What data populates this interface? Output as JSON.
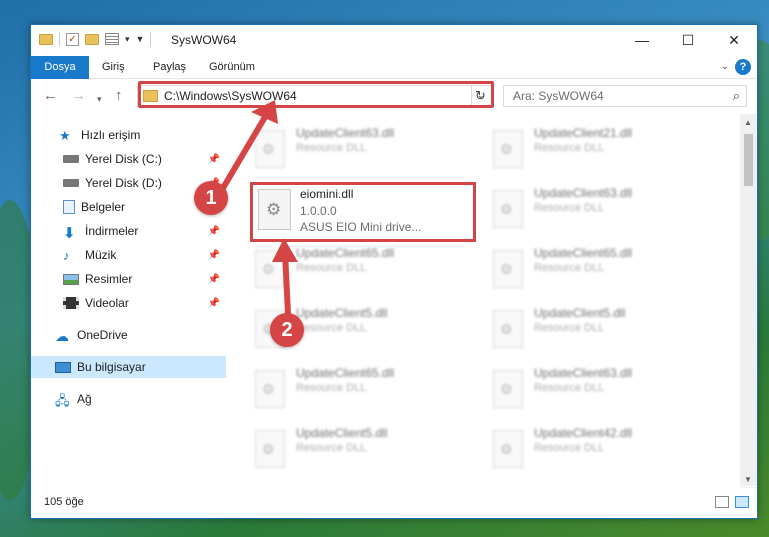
{
  "window": {
    "title": "SysWOW64"
  },
  "window_controls": {
    "minimize": "—",
    "maximize": "☐",
    "close": "✕"
  },
  "ribbon": {
    "tabs": [
      "Dosya",
      "Giriş",
      "Paylaş",
      "Görünüm"
    ],
    "help": "?"
  },
  "address": {
    "path": "C:\\Windows\\SysWOW64",
    "search_placeholder": "Ara: SysWOW64"
  },
  "sidebar": {
    "items": [
      {
        "label": "Hızlı erişim",
        "icon": "star-icon"
      },
      {
        "label": "Yerel Disk (C:)",
        "icon": "drive-icon",
        "pinned": true
      },
      {
        "label": "Yerel Disk (D:)",
        "icon": "drive-icon",
        "pinned": true
      },
      {
        "label": "Belgeler",
        "icon": "documents-icon",
        "pinned": true
      },
      {
        "label": "İndirmeler",
        "icon": "download-icon",
        "pinned": true
      },
      {
        "label": "Müzik",
        "icon": "music-icon",
        "pinned": true
      },
      {
        "label": "Resimler",
        "icon": "pictures-icon",
        "pinned": true
      },
      {
        "label": "Videolar",
        "icon": "videos-icon",
        "pinned": true
      },
      {
        "label": "OneDrive",
        "icon": "cloud-icon"
      },
      {
        "label": "Bu bilgisayar",
        "icon": "computer-icon",
        "selected": true
      },
      {
        "label": "Ağ",
        "icon": "network-icon"
      }
    ]
  },
  "files": [
    {
      "name": "UpdateClient63.dll",
      "desc": "Resource DLL"
    },
    {
      "name": "UpdateClient21.dll",
      "desc": "Resource DLL"
    },
    {
      "name": "",
      "desc": ""
    },
    {
      "name": "UpdateClient63.dll",
      "desc": "Resource DLL"
    },
    {
      "name": "UpdateClient65.dll",
      "desc": "Resource DLL"
    },
    {
      "name": "UpdateClient65.dll",
      "desc": "Resource DLL"
    },
    {
      "name": "UpdateClient5.dll",
      "desc": "Resource DLL"
    },
    {
      "name": "UpdateClient5.dll",
      "desc": "Resource DLL"
    },
    {
      "name": "UpdateClient65.dll",
      "desc": "Resource DLL"
    },
    {
      "name": "UpdateClient63.dll",
      "desc": "Resource DLL"
    },
    {
      "name": "UpdateClient5.dll",
      "desc": "Resource DLL"
    },
    {
      "name": "UpdateClient42.dll",
      "desc": "Resource DLL"
    }
  ],
  "highlighted_file": {
    "name": "eiomini.dll",
    "version": "1.0.0.0",
    "desc": "ASUS EIO Mini drive..."
  },
  "annotations": {
    "step1": "1",
    "step2": "2",
    "accent": "#d64545"
  },
  "status": {
    "item_count": "105 öğe"
  }
}
